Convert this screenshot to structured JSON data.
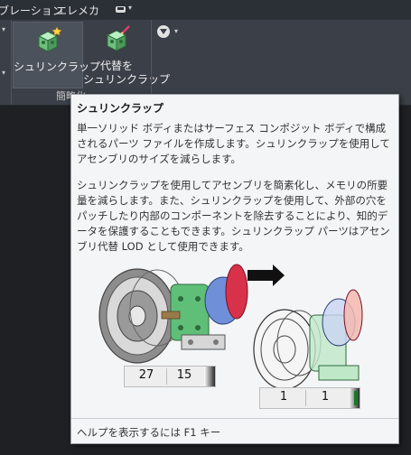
{
  "menu": {
    "items": [
      "ブレーション",
      "エレメカ"
    ],
    "caret": "▾"
  },
  "ribbon": {
    "buttons": [
      {
        "label": "シュリンクラップ"
      },
      {
        "label_line1": "代替を",
        "label_line2": "シュリンクラップ"
      }
    ],
    "panel_label": "簡略化",
    "caret": "▾"
  },
  "tooltip": {
    "title": "シュリンクラップ",
    "paragraph1": "単一ソリッド ボディまたはサーフェス コンポジット ボディで構成されるパーツ ファイルを作成します。シュリンクラップを使用してアセンブリのサイズを減らします。",
    "paragraph2": "シュリンクラップを使用してアセンブリを簡素化し、メモリの所要量を減らします。また、シュリンクラップを使用して、外部の穴をパッチしたり内部のコンポーネントを除去することにより、知的データを保護することもできます。シュリンクラップ パーツはアセンブリ代替 LOD として使用できます。",
    "counter_before": [
      "27",
      "15"
    ],
    "counter_after": [
      "1",
      "1"
    ],
    "help": "ヘルプを表示するには F1 キー"
  },
  "colors": {
    "ribbon_bg": "#3b3f47",
    "tooltip_bg": "#f4f5f7",
    "active_green": "#0c7f1f"
  }
}
